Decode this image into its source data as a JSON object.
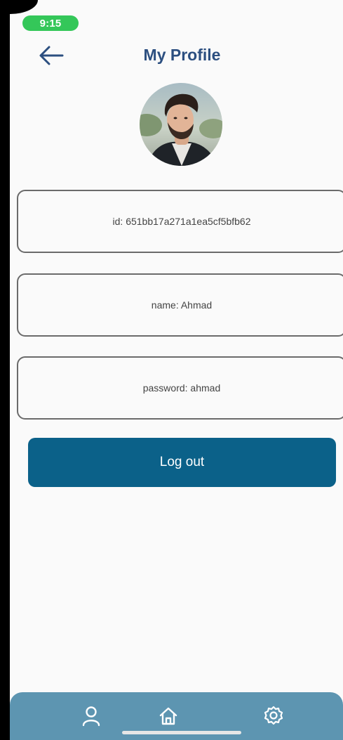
{
  "status_bar": {
    "time": "9:15"
  },
  "header": {
    "back_icon": "arrow-left-icon",
    "title": "My Profile"
  },
  "profile": {
    "avatar_alt": "profile photo",
    "fields": {
      "id": "id: 651bb17a271a1ea5cf5bfb62",
      "name": "name: Ahmad",
      "password": "password: ahmad"
    }
  },
  "actions": {
    "logout_label": "Log out"
  },
  "tab_bar": {
    "items": [
      {
        "icon": "user-icon"
      },
      {
        "icon": "home-icon"
      },
      {
        "icon": "gear-icon"
      }
    ]
  },
  "colors": {
    "accent": "#0b6189",
    "title": "#2c4f80",
    "tab_bar": "#5d95b1",
    "status_pill": "#34c759"
  }
}
